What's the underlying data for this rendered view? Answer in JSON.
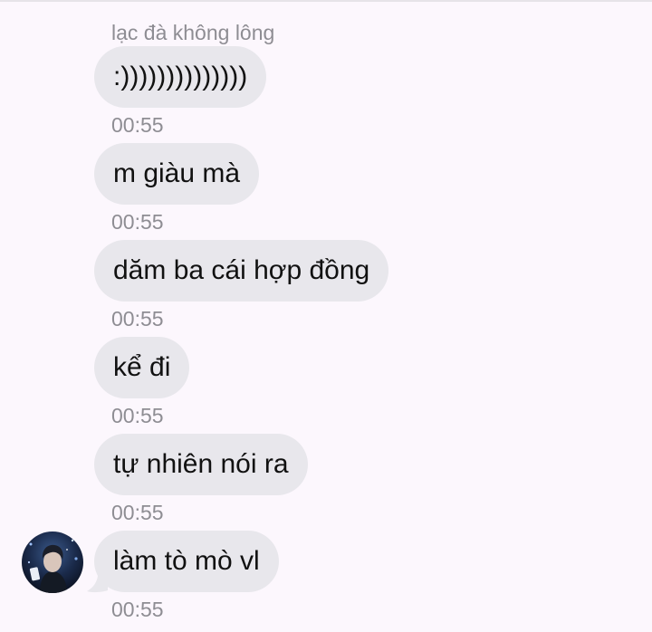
{
  "sender": {
    "name": "lạc đà không lông"
  },
  "messages": [
    {
      "text": ":))))))))))))))",
      "time": "00:55"
    },
    {
      "text": "m giàu mà",
      "time": "00:55"
    },
    {
      "text": "dăm ba cái hợp đồng",
      "time": "00:55"
    },
    {
      "text": "kể đi",
      "time": "00:55"
    },
    {
      "text": "tự nhiên nói ra",
      "time": "00:55"
    },
    {
      "text": "làm tò mò vl",
      "time": "00:55"
    }
  ],
  "colors": {
    "background": "#fcf7fd",
    "bubble": "#e8e7ec",
    "timestamp": "#8e8d93"
  },
  "icons": {
    "avatar": "user-avatar-photo"
  }
}
